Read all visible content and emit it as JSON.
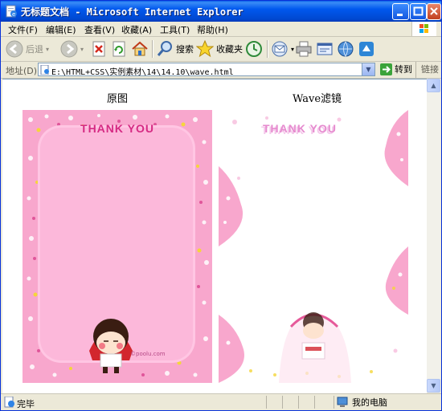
{
  "window": {
    "title": "无标题文档 - Microsoft Internet Explorer"
  },
  "menu": [
    {
      "label": "文件(F)"
    },
    {
      "label": "编辑(E)"
    },
    {
      "label": "查看(V)"
    },
    {
      "label": "收藏(A)"
    },
    {
      "label": "工具(T)"
    },
    {
      "label": "帮助(H)"
    }
  ],
  "toolbar": {
    "back_label": "后退",
    "search_label": "搜索",
    "favorites_label": "收藏夹"
  },
  "address": {
    "label": "地址(D)",
    "url": "E:\\HTML+CSS\\实例素材\\14\\14.10\\wave.html",
    "go_label": "转到",
    "links_label": "链接"
  },
  "page": {
    "original_caption": "原图",
    "wave_caption": "Wave滤镜",
    "card_text": "THANK YOU",
    "watermark": "©poolu.com"
  },
  "status": {
    "text": "完毕",
    "zone": "我的电脑"
  }
}
